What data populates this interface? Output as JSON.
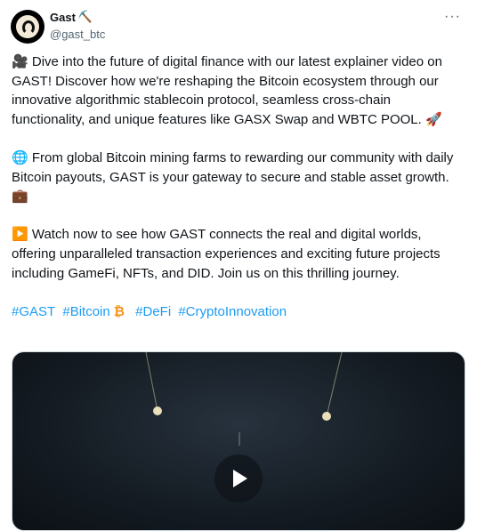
{
  "author": {
    "name": "Gast",
    "name_emoji": "⛏️",
    "handle": "@gast_btc"
  },
  "menu": {
    "more_glyph": "···"
  },
  "tweet": {
    "para1_emoji": "🎥",
    "para1": " Dive into the future of digital finance with our latest explainer video on GAST! Discover how we're reshaping the Bitcoin ecosystem through our innovative algorithmic stablecoin protocol, seamless cross-chain functionality, and unique features like GASX Swap and WBTC POOL. ",
    "para1_end_emoji": "🚀",
    "para2_emoji": "🌐",
    "para2": " From global Bitcoin mining farms to rewarding our community with daily Bitcoin payouts, GAST is your gateway to secure and stable asset growth. ",
    "para2_end_emoji": "💼",
    "para3_emoji": "▶️",
    "para3": " Watch now to see how GAST connects the real and digital worlds, offering unparalleled transaction experiences and exciting future projects including GameFi, NFTs, and DID. Join us on this thrilling journey.",
    "hashtags": [
      "#GAST",
      "#Bitcoin",
      "#DeFi",
      "#CryptoInnovation"
    ],
    "bitcoin_emoji": "₿"
  },
  "media": {
    "type": "video",
    "play_icon": "play-icon"
  },
  "colors": {
    "link": "#1d9bf0",
    "text": "#0f1419",
    "secondary": "#536471"
  }
}
